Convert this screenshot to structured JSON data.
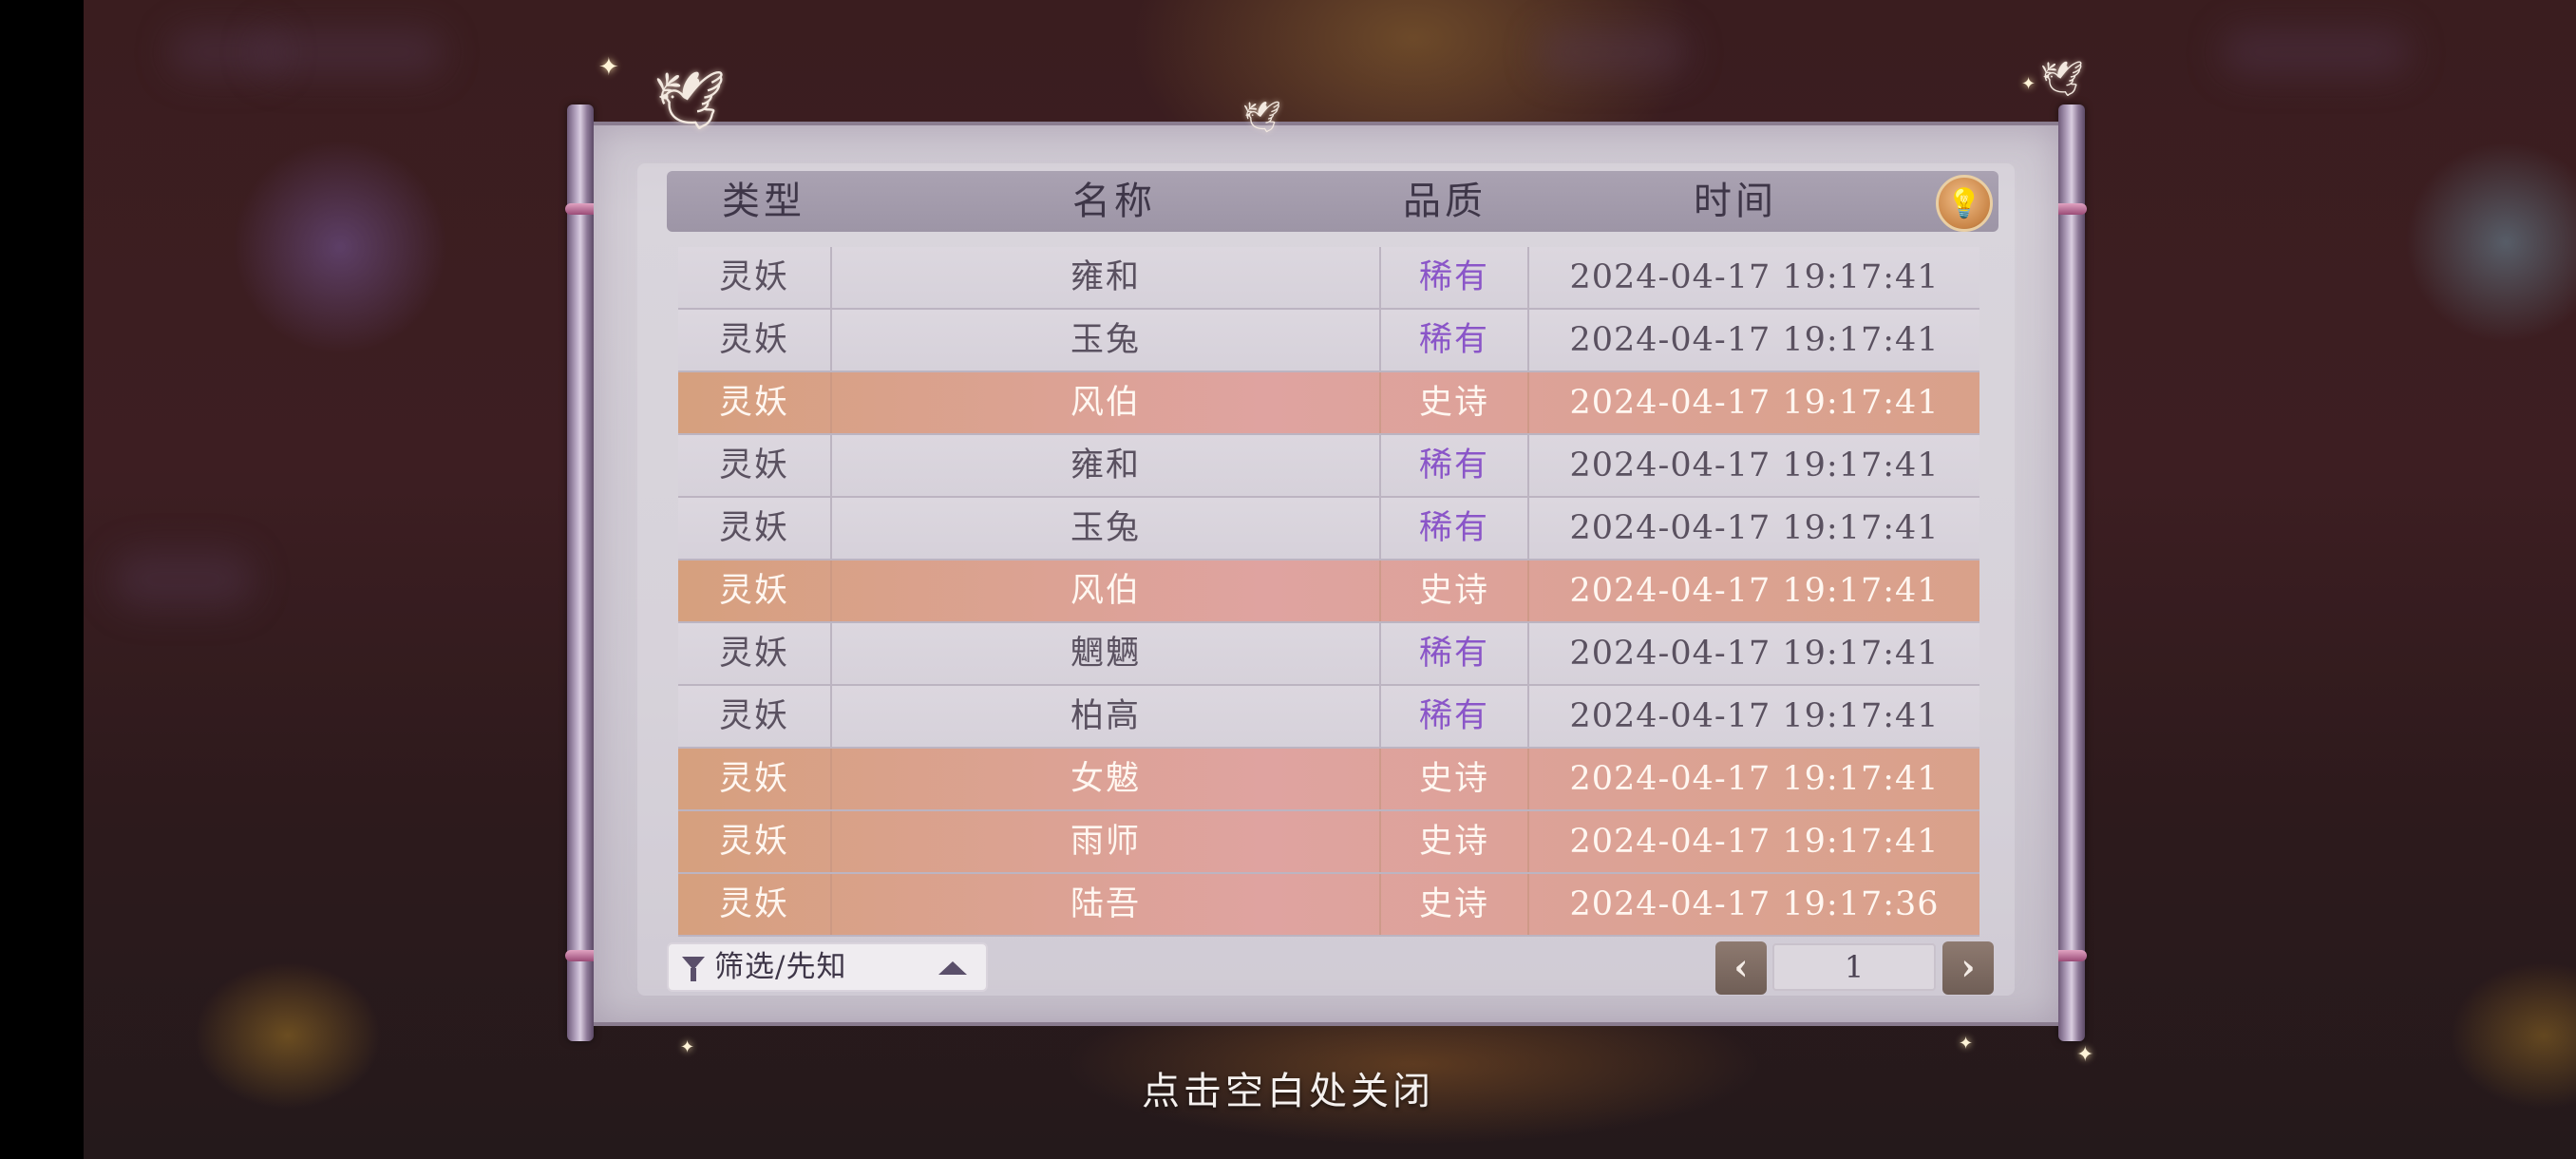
{
  "table": {
    "headers": {
      "type": "类型",
      "name": "名称",
      "quality": "品质",
      "time": "时间"
    },
    "rows": [
      {
        "type": "灵妖",
        "name": "雍和",
        "quality": "稀有",
        "time": "2024-04-17  19:17:41",
        "tier": "rare"
      },
      {
        "type": "灵妖",
        "name": "玉兔",
        "quality": "稀有",
        "time": "2024-04-17  19:17:41",
        "tier": "rare"
      },
      {
        "type": "灵妖",
        "name": "风伯",
        "quality": "史诗",
        "time": "2024-04-17  19:17:41",
        "tier": "epic"
      },
      {
        "type": "灵妖",
        "name": "雍和",
        "quality": "稀有",
        "time": "2024-04-17  19:17:41",
        "tier": "rare"
      },
      {
        "type": "灵妖",
        "name": "玉兔",
        "quality": "稀有",
        "time": "2024-04-17  19:17:41",
        "tier": "rare"
      },
      {
        "type": "灵妖",
        "name": "风伯",
        "quality": "史诗",
        "time": "2024-04-17  19:17:41",
        "tier": "epic"
      },
      {
        "type": "灵妖",
        "name": "魍魉",
        "quality": "稀有",
        "time": "2024-04-17  19:17:41",
        "tier": "rare"
      },
      {
        "type": "灵妖",
        "name": "柏高",
        "quality": "稀有",
        "time": "2024-04-17  19:17:41",
        "tier": "rare"
      },
      {
        "type": "灵妖",
        "name": "女魃",
        "quality": "史诗",
        "time": "2024-04-17  19:17:41",
        "tier": "epic"
      },
      {
        "type": "灵妖",
        "name": "雨师",
        "quality": "史诗",
        "time": "2024-04-17  19:17:41",
        "tier": "epic"
      },
      {
        "type": "灵妖",
        "name": "陆吾",
        "quality": "史诗",
        "time": "2024-04-17  19:17:36",
        "tier": "epic"
      }
    ]
  },
  "filter": {
    "label": "筛选/先知",
    "icon": "funnel-icon"
  },
  "pagination": {
    "current_page": "1",
    "prev_icon": "chevron-left-icon",
    "next_icon": "chevron-right-icon"
  },
  "close_hint": "点击空白处关闭",
  "colors": {
    "rare_text": "#8a55c8",
    "epic_row": "#d6a07e",
    "header_bar": "#9d95a6"
  }
}
